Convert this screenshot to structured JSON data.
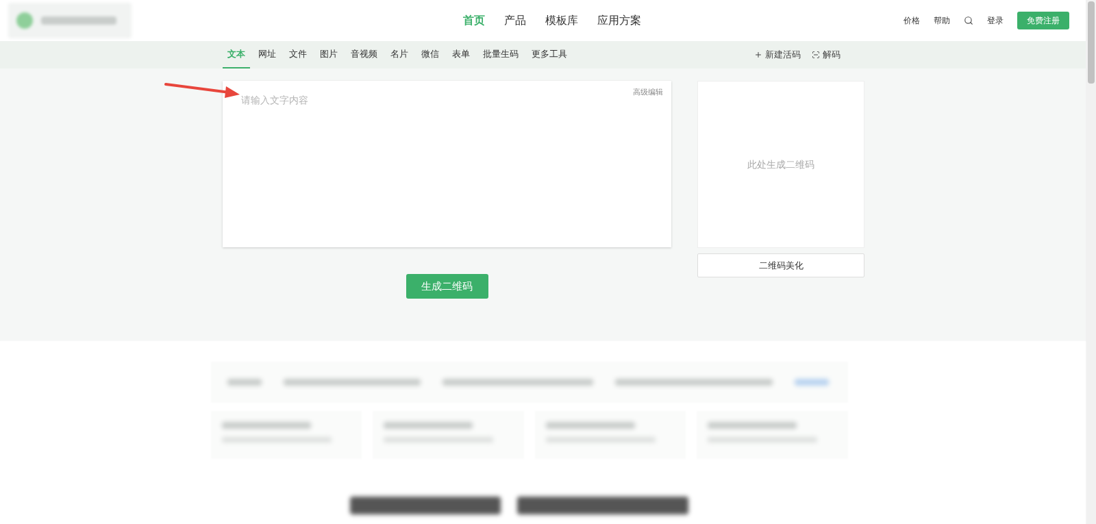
{
  "nav": [
    {
      "label": "首页",
      "selected": true
    },
    {
      "label": "产品",
      "selected": false
    },
    {
      "label": "模板库",
      "selected": false
    },
    {
      "label": "应用方案",
      "selected": false
    }
  ],
  "header_links": [
    "价格",
    "帮助"
  ],
  "login": "登录",
  "register": "免费注册",
  "tabs": [
    {
      "label": "文本",
      "selected": true
    },
    {
      "label": "网址",
      "selected": false
    },
    {
      "label": "文件",
      "selected": false
    },
    {
      "label": "图片",
      "selected": false
    },
    {
      "label": "音视频",
      "selected": false
    },
    {
      "label": "名片",
      "selected": false
    },
    {
      "label": "微信",
      "selected": false
    },
    {
      "label": "表单",
      "selected": false
    },
    {
      "label": "批量生码",
      "selected": false
    },
    {
      "label": "更多工具",
      "selected": false
    }
  ],
  "tools": [
    {
      "kind": "new",
      "label": "新建活码"
    },
    {
      "kind": "decode",
      "label": "解码"
    }
  ],
  "editor": {
    "placeholder": "请输入文字内容",
    "advanced": "高级编辑"
  },
  "generate_button": "生成二维码",
  "qr_preview": {
    "hint": "此处生成二维码",
    "beautify_button": "二维码美化"
  }
}
